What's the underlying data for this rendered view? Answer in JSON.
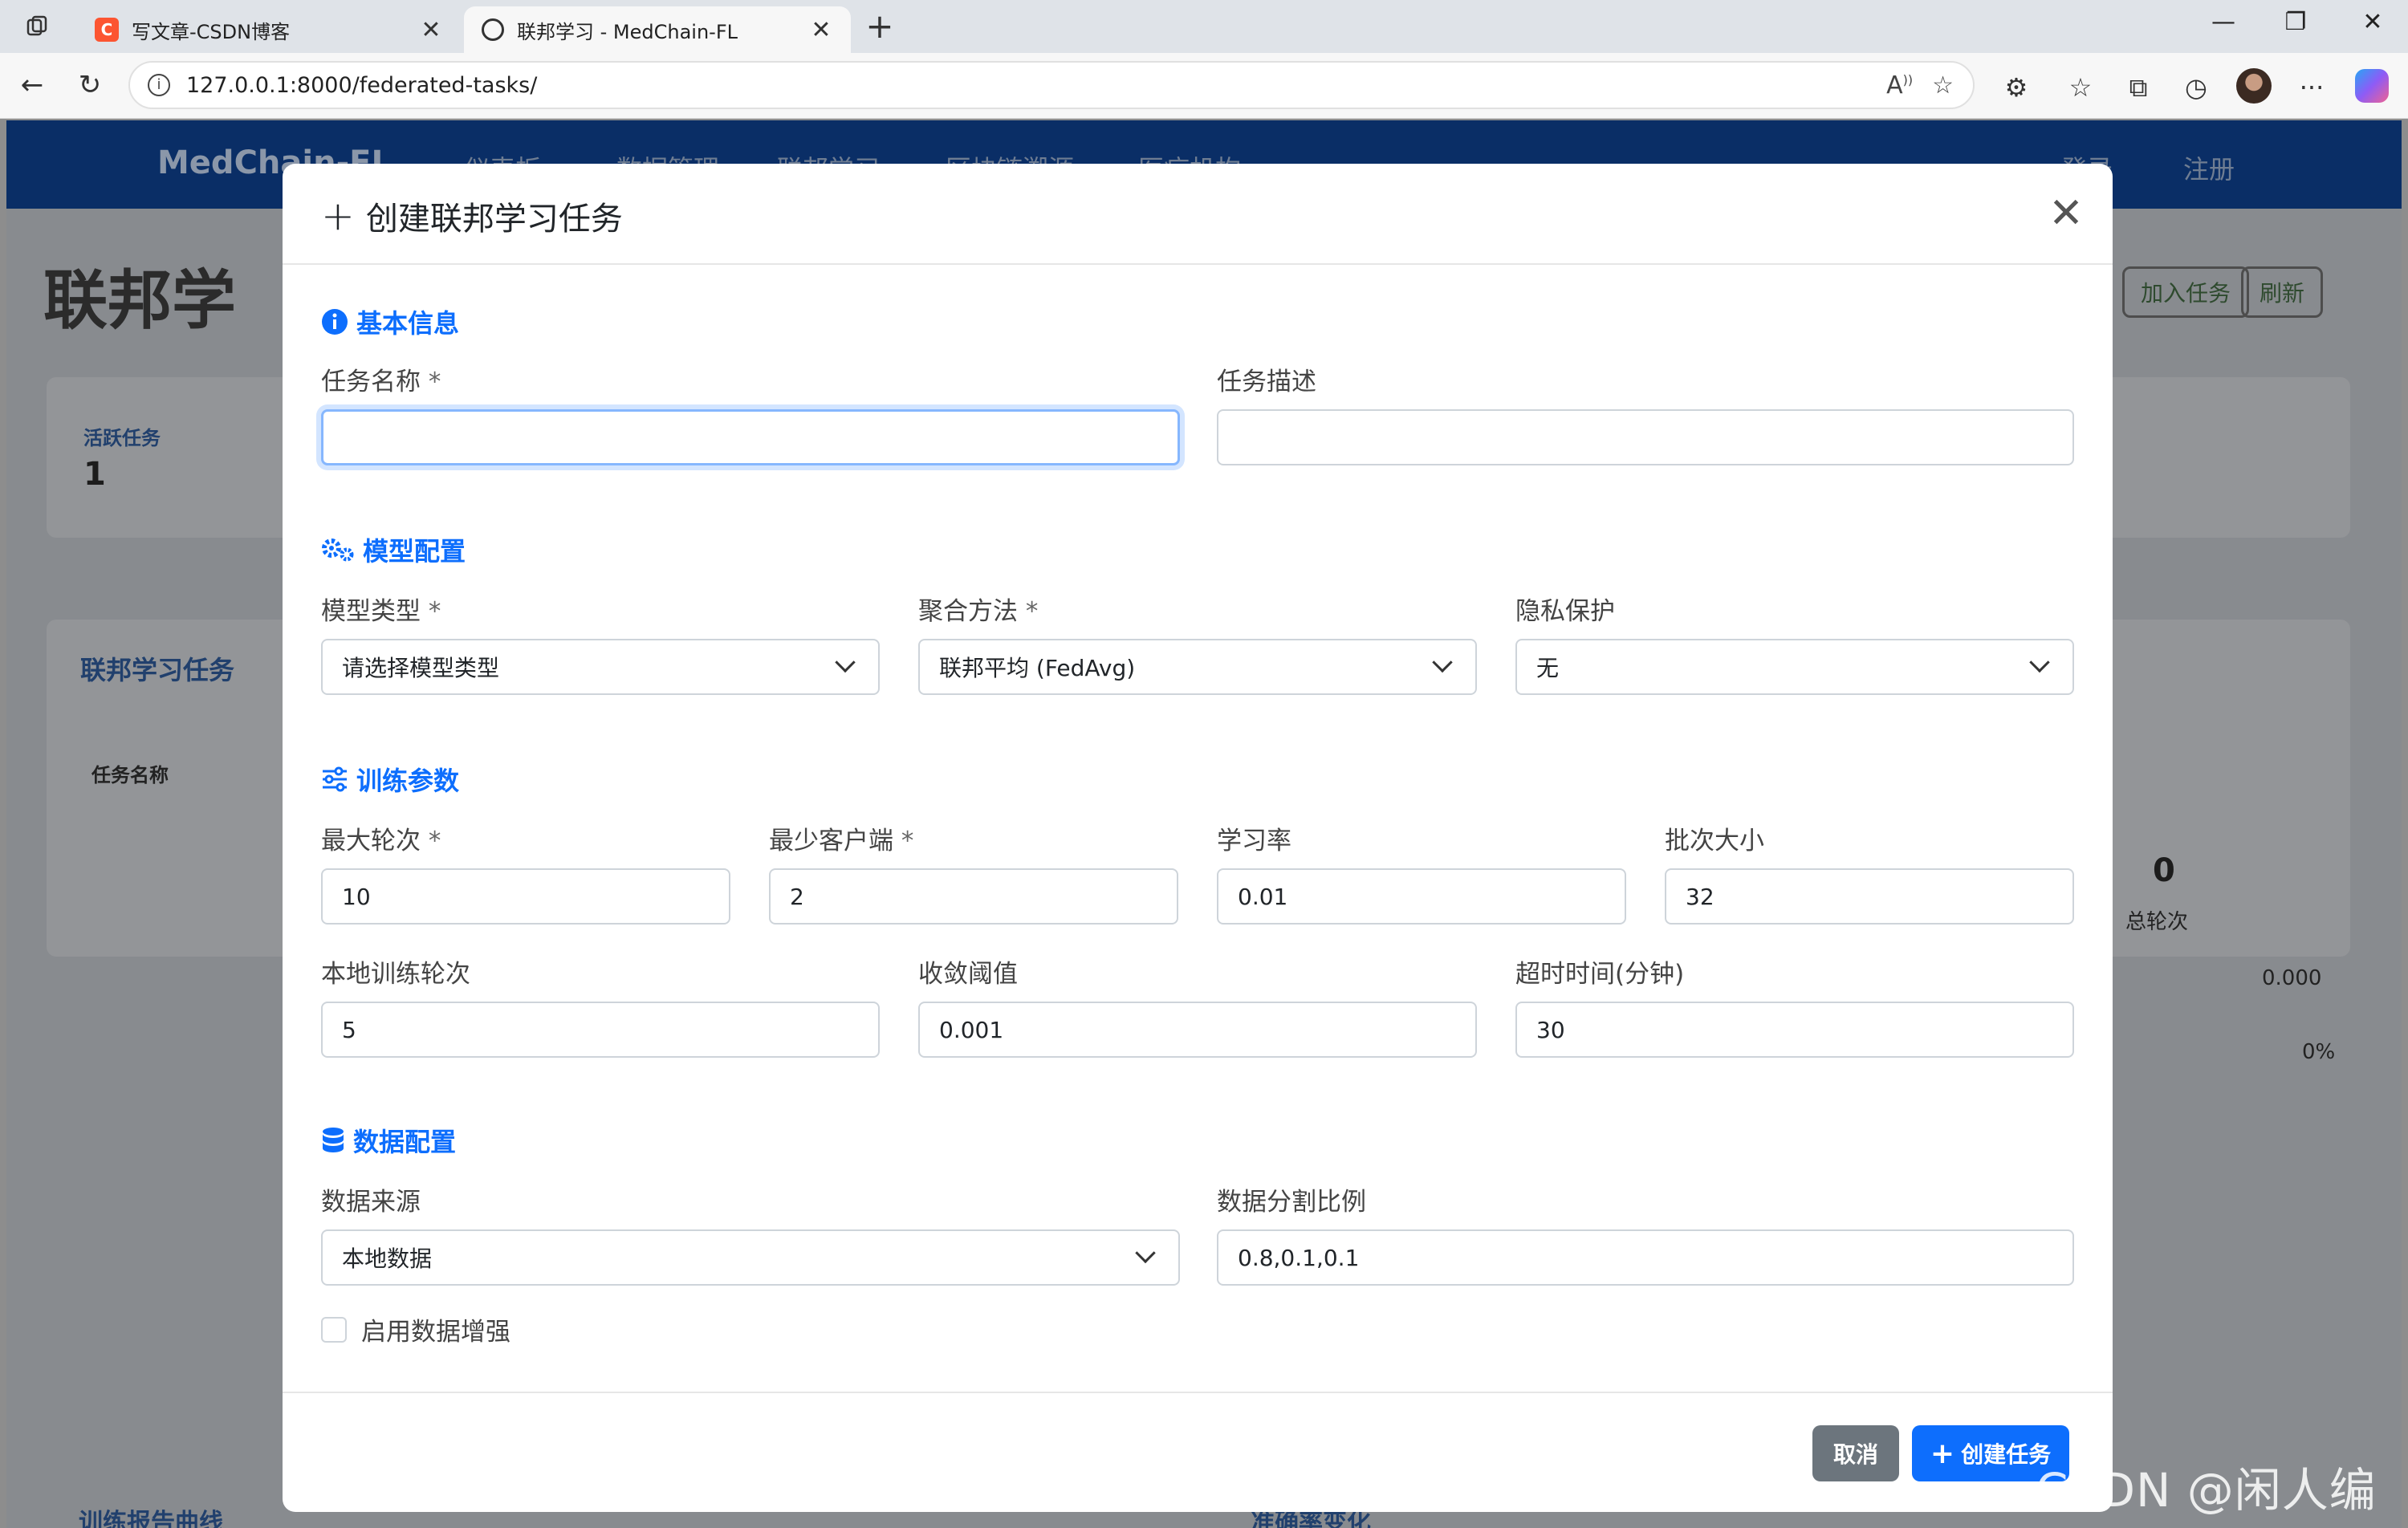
{
  "browser": {
    "tabs": [
      {
        "title": "写文章-CSDN博客",
        "favicon_text": "C"
      },
      {
        "title": "联邦学习 - MedChain-FL"
      }
    ],
    "url": "127.0.0.1:8000/federated-tasks/"
  },
  "background": {
    "brand": "MedChain-FL",
    "nav": [
      "仪表板",
      "数据管理",
      "联邦学习",
      "区块链溯源",
      "医疗机构"
    ],
    "auth": [
      "登录",
      "注册"
    ],
    "page_title": "联邦学",
    "buttons": {
      "join": "加入任务",
      "refresh": "刷新"
    },
    "stat_label": "活跃任务",
    "stat_value": "1",
    "list_title": "联邦学习任务",
    "table_header": "任务名称",
    "rounds_value": "0",
    "rounds_label": "总轮次",
    "metric_value": "0.000",
    "progress_value": "0%",
    "bottom_left": "训练报告曲线",
    "bottom_right": "准确率变化"
  },
  "modal": {
    "title": "创建联邦学习任务",
    "sections": {
      "basic": "基本信息",
      "model": "模型配置",
      "training": "训练参数",
      "data": "数据配置"
    },
    "fields": {
      "task_name": {
        "label": "任务名称",
        "required": "*",
        "value": ""
      },
      "task_desc": {
        "label": "任务描述",
        "value": ""
      },
      "model_type": {
        "label": "模型类型",
        "required": "*",
        "value": "请选择模型类型"
      },
      "aggregation": {
        "label": "聚合方法",
        "required": "*",
        "value": "联邦平均 (FedAvg)"
      },
      "privacy": {
        "label": "隐私保护",
        "value": "无"
      },
      "max_rounds": {
        "label": "最大轮次",
        "required": "*",
        "value": "10"
      },
      "min_clients": {
        "label": "最少客户端",
        "required": "*",
        "value": "2"
      },
      "learning_rate": {
        "label": "学习率",
        "value": "0.01"
      },
      "batch_size": {
        "label": "批次大小",
        "value": "32"
      },
      "local_epochs": {
        "label": "本地训练轮次",
        "value": "5"
      },
      "convergence": {
        "label": "收敛阈值",
        "value": "0.001"
      },
      "timeout": {
        "label": "超时时间(分钟)",
        "value": "30"
      },
      "data_source": {
        "label": "数据来源",
        "value": "本地数据"
      },
      "data_split": {
        "label": "数据分割比例",
        "value": "0.8,0.1,0.1"
      },
      "augmentation": {
        "label": "启用数据增强"
      }
    },
    "buttons": {
      "cancel": "取消",
      "create": "创建任务"
    }
  },
  "watermark": "CSDN @闲人编程",
  "colors": {
    "primary": "#0d6efd",
    "secondary": "#6c757d",
    "navbar": "#0a2e66"
  }
}
